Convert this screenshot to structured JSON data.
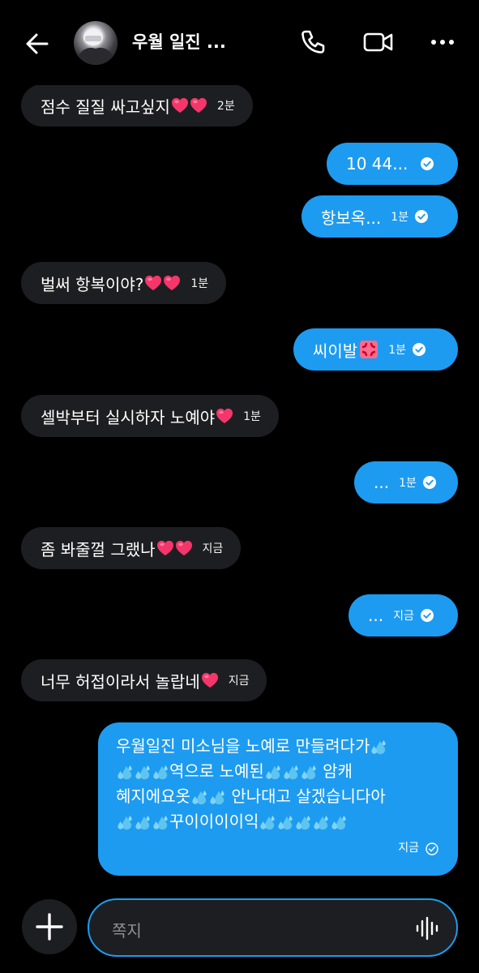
{
  "header": {
    "name": "우월 일진 ...",
    "icons": [
      "back-arrow-icon",
      "phone-icon",
      "video-icon",
      "more-icon"
    ]
  },
  "messages": [
    {
      "dir": "in",
      "text": "점수 질질 싸고싶지",
      "emoji": "heart heart",
      "time": "2분"
    },
    {
      "dir": "out",
      "text": "10 44...",
      "time": ""
    },
    {
      "dir": "out",
      "text": "항보옥...",
      "time": "1분"
    },
    {
      "dir": "in",
      "text": "벌써 항복이야?",
      "emoji": "heart heart",
      "time": "1분"
    },
    {
      "dir": "out",
      "text": "씨이발",
      "emoji": "anger",
      "time": "1분"
    },
    {
      "dir": "in",
      "text": "셀박부터 실시하자 노예야",
      "emoji": "heart",
      "time": "1분"
    },
    {
      "dir": "out",
      "text": "...",
      "time": "1분"
    },
    {
      "dir": "in",
      "text": "좀 봐줄껄 그랬나",
      "emoji": "heart heart",
      "time": "지금"
    },
    {
      "dir": "out",
      "text": "...",
      "time": "지금"
    },
    {
      "dir": "in",
      "text": "너무 허접이라서 놀랍네",
      "emoji": "heart",
      "time": "지금"
    }
  ],
  "last_message": {
    "line1": "우월일진 미소님을 노예로 만들려다가",
    "line2": "역으로 노예된",
    "line2b": " 암캐",
    "line3": "혜지에요옷",
    "line3b": " 안나대고 살겠습니다아",
    "line4": "꾸이이이이익",
    "time": "지금"
  },
  "composer": {
    "placeholder": "쪽지"
  },
  "colors": {
    "background": "#000000",
    "incoming_bubble": "#1d1e21",
    "outgoing_bubble": "#1d9bf0",
    "composer_border": "#1d9bf0"
  }
}
